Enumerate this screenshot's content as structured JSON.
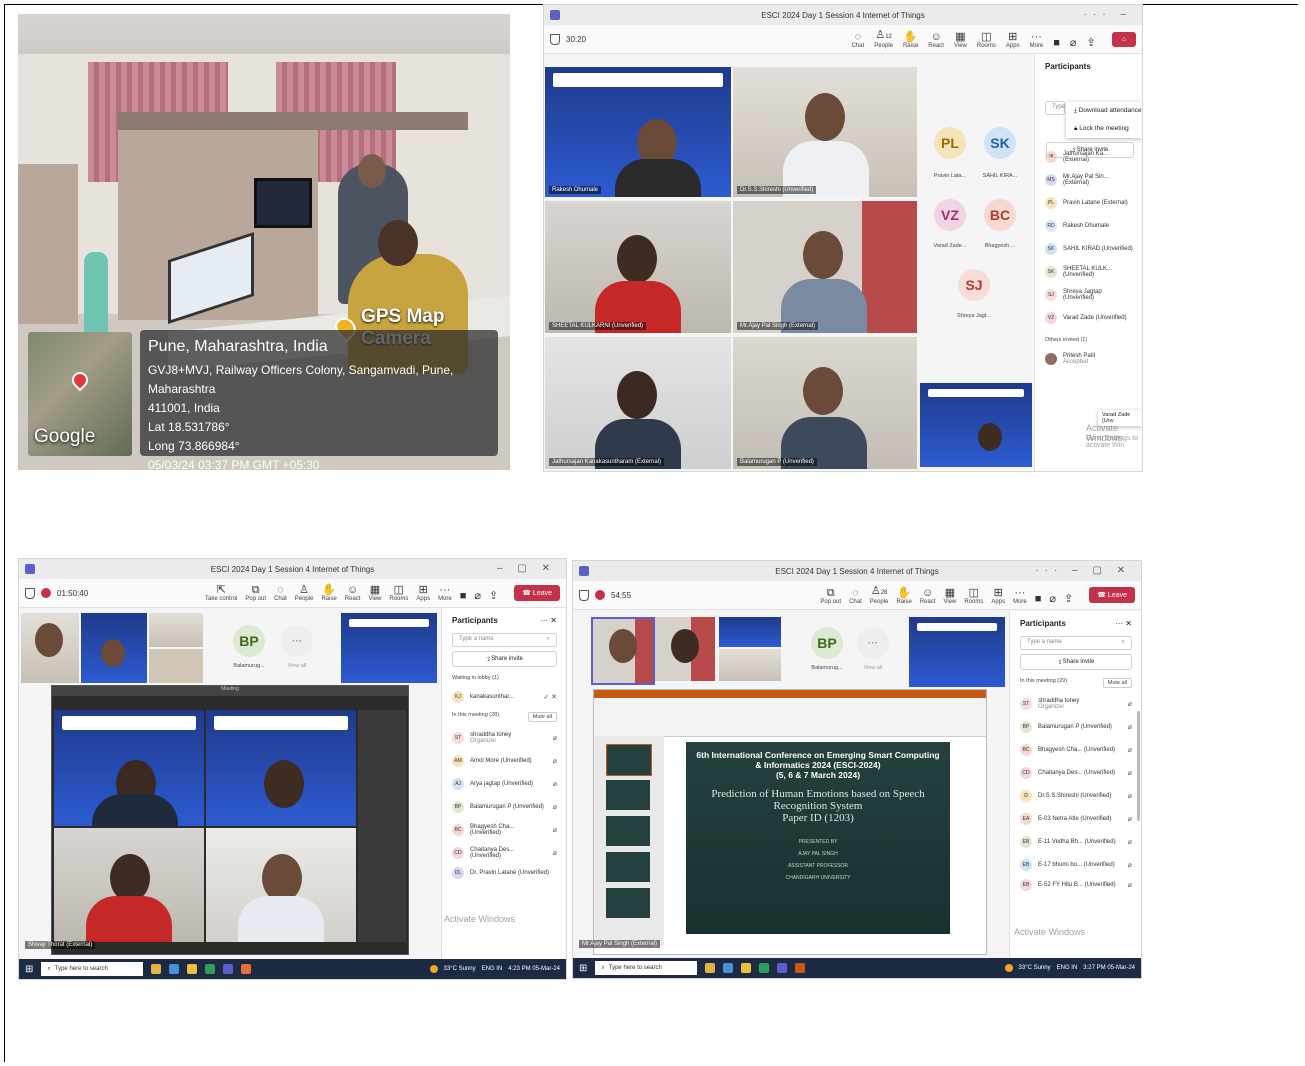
{
  "photo": {
    "camera_label": "GPS Map Camera",
    "map_label": "Google",
    "city": "Pune, Maharashtra, India",
    "address_line1": "GVJ8+MVJ, Railway Officers Colony, Sangamvadi, Pune, Maharashtra",
    "address_line2": "411001, India",
    "lat": "Lat 18.531786°",
    "long": "Long 73.866984°",
    "datetime": "05/03/24 03:37 PM GMT +05:30"
  },
  "teams_common": {
    "window_title": "ESCI 2024 Day 1 Session 4 Internet of Things",
    "tools": [
      "Chat",
      "People",
      "Raise",
      "React",
      "View",
      "Rooms",
      "Apps",
      "More"
    ],
    "leave_label": "Leave",
    "participants_title": "Participants",
    "search_placeholder": "Type a name",
    "share_invite": "Share invite",
    "mute_all": "Mute all",
    "watermark": "Activate Windows",
    "taskbar_search": "Type here to search"
  },
  "win1": {
    "timer": "30:20",
    "people_count": "12",
    "tiles": [
      {
        "label": "Rakesh Dhumale"
      },
      {
        "label": "Dr.S.S.Shireshi (Unverified)"
      },
      {
        "label": "SHEETAL KULKARNI (Unverified)"
      },
      {
        "label": "Mr.Ajay Pal Singh (External)"
      },
      {
        "label": "Jathursajan Kanakasuntharam (External)"
      },
      {
        "label": "Balamurugan P (Unverified)"
      }
    ],
    "avatars": [
      {
        "initials": "PL",
        "caption": "Pravin Lata...",
        "color": "#f6e4b8",
        "text": "#9a6b00"
      },
      {
        "initials": "SK",
        "caption": "SAHIL KIRA...",
        "color": "#cfe3f7",
        "text": "#1d5fa8"
      },
      {
        "initials": "VZ",
        "caption": "Varad Zade...",
        "color": "#f3d4e4",
        "text": "#a32d6a"
      },
      {
        "initials": "BC",
        "caption": "Bhagyesh ...",
        "color": "#f7d9d2",
        "text": "#b23a28"
      },
      {
        "initials": "SJ",
        "caption": "Shreya Jagt...",
        "color": "#f8dcd8",
        "text": "#b33a2e"
      }
    ],
    "menu": [
      "Download attendance",
      "Lock the meeting"
    ],
    "search_partial": "Type",
    "participants": [
      {
        "initials": "JK",
        "name": "Jathursajan Ka... (External)",
        "color": "#f7d9d2"
      },
      {
        "initials": "MS",
        "name": "Mr.Ajay Pal Sin... (External)",
        "color": "#dcd6f2"
      },
      {
        "initials": "PL",
        "name": "Pravin Latane (External)",
        "color": "#f6e4b8"
      },
      {
        "initials": "RD",
        "name": "Rakesh Dhumale",
        "color": "#dce7f7"
      },
      {
        "initials": "SK",
        "name": "SAHIL KIRAD (Unverified)",
        "color": "#cfe3f7"
      },
      {
        "initials": "SK",
        "name": "SHEETAL KULK... (Unverified)",
        "color": "#dde9d2"
      },
      {
        "initials": "SJ",
        "name": "Shreya Jagtap (Unverified)",
        "color": "#f8dcd8"
      },
      {
        "initials": "VZ",
        "name": "Varad Zade (Unverified)",
        "color": "#f3d4e4"
      }
    ],
    "tooltip": "Varad Zade (Unv",
    "others_invited": "Others invited (1)",
    "invited_name": "Pritesh Patil",
    "invited_status": "Accepted",
    "watermark_sub": "Go to Settings to activate Win"
  },
  "win2": {
    "timer": "01:50:40",
    "extra_tools": [
      "Take control",
      "Pop out"
    ],
    "avatar": {
      "initials": "BP",
      "caption": "Balamurug..."
    },
    "view_all": "View all",
    "inner_title": "Meeting",
    "waiting_header": "Waiting in lobby (1)",
    "waiting_name": "kanakasunthar...",
    "waiting_initials": "KJ",
    "in_meeting_header": "In this meeting (28)",
    "participants": [
      {
        "initials": "ST",
        "name": "shraddha toney",
        "sub": "Organizer",
        "color": "#f8dcd8"
      },
      {
        "initials": "AM",
        "name": "Amol More (Unverified)",
        "sub": "",
        "color": "#f6e4b8"
      },
      {
        "initials": "AJ",
        "name": "Arya jagtap (Unverified)",
        "sub": "",
        "color": "#cfe3f7"
      },
      {
        "initials": "BP",
        "name": "Balamurugan P (Unverified)",
        "sub": "",
        "color": "#dde9d2"
      },
      {
        "initials": "BC",
        "name": "Bhagyesh Cha... (Unverified)",
        "sub": "",
        "color": "#f7d9d2"
      },
      {
        "initials": "CD",
        "name": "Chaitanya Des... (Unverified)",
        "sub": "",
        "color": "#f3d4e4"
      },
      {
        "initials": "DL",
        "name": "Dr. Pravin Latane (Unverified)",
        "sub": "",
        "color": "#dcd6f2"
      }
    ],
    "small_label": "Shivaji Thorat (External)",
    "weather": "33°C Sunny",
    "lang": "ENG IN",
    "time": "4:23 PM",
    "date": "05-Mar-24"
  },
  "win3": {
    "timer": "54:55",
    "people_count": "28",
    "extra_tools": [
      "Pop out"
    ],
    "avatar": {
      "initials": "BP",
      "caption": "Balamurug..."
    },
    "view_all": "View all",
    "slide": {
      "heading_main": "6th International Conference on Emerging Smart Computing",
      "heading_sub": "& Informatics 2024 (ESCI-2024)",
      "dates": "(5, 6 & 7 March 2024)",
      "paper_title_1": "Prediction of Human Emotions based on Speech",
      "paper_title_2": "Recognition System",
      "paper_id": "Paper ID (1203)",
      "presented_by": "PRESENTED BY",
      "presenter": "AJAY PAL SINGH",
      "role": "ASSISTANT PROFESSOR",
      "org": "CHANDIGARH UNIVERSITY"
    },
    "in_meeting_header": "In this meeting (29)",
    "participants": [
      {
        "initials": "ST",
        "name": "shraddha toney",
        "sub": "Organizer",
        "color": "#f8dcd8"
      },
      {
        "initials": "BP",
        "name": "Balamurugan P (Unverified)",
        "sub": "",
        "color": "#dde9d2"
      },
      {
        "initials": "BC",
        "name": "Bhagyesh Cha... (Unverified)",
        "sub": "",
        "color": "#f7d9d2"
      },
      {
        "initials": "CD",
        "name": "Chaitanya Des... (Unverified)",
        "sub": "",
        "color": "#f3d4e4"
      },
      {
        "initials": "D",
        "name": "Dr.S.S.Shireshi (Unverified)",
        "sub": "",
        "color": "#f6e4b8"
      },
      {
        "initials": "EA",
        "name": "E-03 Netra Atle (Unverified)",
        "sub": "",
        "color": "#f7d9d2"
      },
      {
        "initials": "EB",
        "name": "E-11 Vedha Bh... (Unverified)",
        "sub": "",
        "color": "#dde9d2"
      },
      {
        "initials": "EB",
        "name": "E-17 bhumi bo... (Unverified)",
        "sub": "",
        "color": "#cfe3f7"
      },
      {
        "initials": "EB",
        "name": "E-52 FY Hitu B... (Unverified)",
        "sub": "",
        "color": "#f3d4e4"
      }
    ],
    "small_label": "Mr.Ajay Pal Singh (External)",
    "weather": "33°C Sunny",
    "lang": "ENG IN",
    "time": "3:27 PM",
    "date": "05-Mar-24"
  }
}
